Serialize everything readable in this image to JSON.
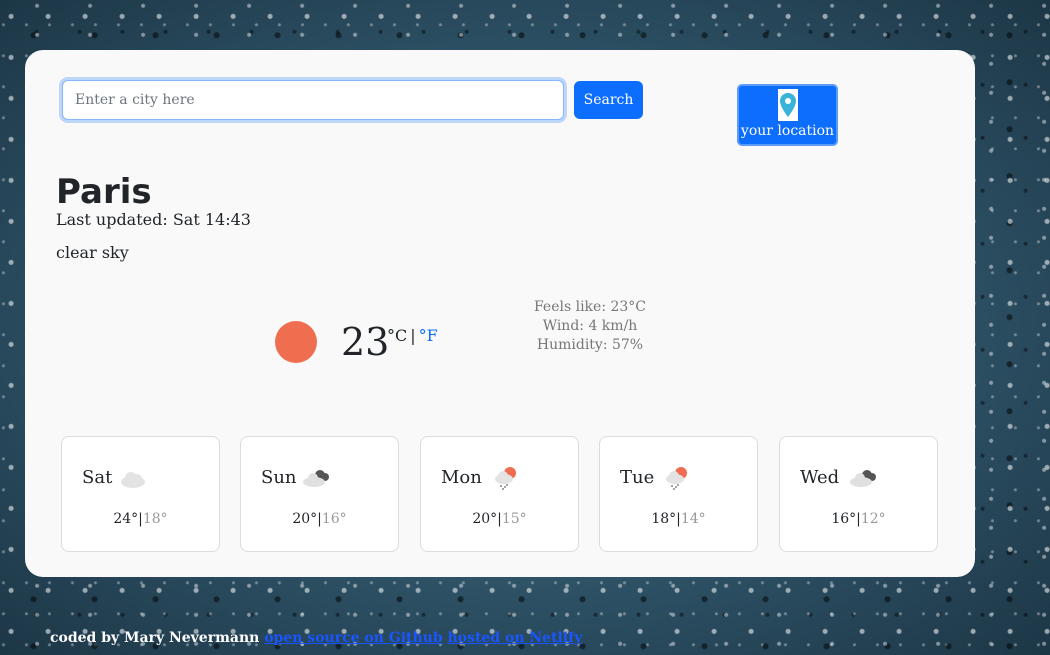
{
  "search": {
    "placeholder": "Enter a city here",
    "button_label": "Search"
  },
  "location_button": {
    "label": "your location",
    "icon": "map-pin-icon"
  },
  "current": {
    "city": "Paris",
    "last_updated": "Last updated: Sat 14:43",
    "description": "clear sky",
    "icon": "sun-icon",
    "temperature": "23",
    "unit_celsius": "°C",
    "unit_separator": "|",
    "unit_fahrenheit": "°F",
    "feels_like": "Feels like: 23°C",
    "wind": "Wind: 4 km/h",
    "humidity": "Humidity: 57%"
  },
  "forecast": [
    {
      "day": "Sat",
      "icon": "cloud-icon",
      "max": "24°",
      "sep": "|",
      "min": "18°"
    },
    {
      "day": "Sun",
      "icon": "broken-clouds-icon",
      "max": "20°",
      "sep": "|",
      "min": "16°"
    },
    {
      "day": "Mon",
      "icon": "sun-rain-icon",
      "max": "20°",
      "sep": "|",
      "min": "15°"
    },
    {
      "day": "Tue",
      "icon": "sun-rain-icon",
      "max": "18°",
      "sep": "|",
      "min": "14°"
    },
    {
      "day": "Wed",
      "icon": "broken-clouds-icon",
      "max": "16°",
      "sep": "|",
      "min": "12°"
    }
  ],
  "footer": {
    "credit": "coded by Mary Nevermann ",
    "link1": "open source on Github",
    "link_sep": " ",
    "link2": "hosted on Netlify"
  },
  "colors": {
    "accent": "#0d6efd",
    "sun": "#ee6e4f",
    "card": "#f9f9f9"
  }
}
